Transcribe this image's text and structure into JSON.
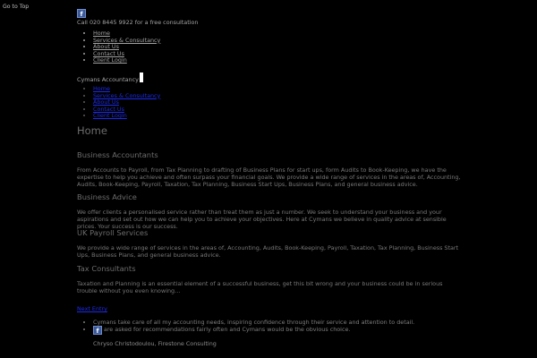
{
  "goto_top": "Go to Top",
  "header": {
    "facebook_icon": "facebook-icon",
    "call_text": "Call 020 8445 9922 for a free consultation",
    "nav": [
      "Home",
      "Services & Consultancy",
      "About Us",
      "Contact Us",
      "Client Login"
    ],
    "brand": "Cymans Accountancy"
  },
  "sub_nav": [
    "Home",
    "Services & Consultancy",
    "About Us",
    "Contact Us",
    "Client Login"
  ],
  "main": {
    "title": "Home",
    "sections": [
      {
        "heading": "Business Accountants",
        "text": "From Accounts to Payroll, from Tax Planning to drafting of Business Plans for start ups, form Audits to Book-Keeping, we have the expertise to help you achieve and often surpass your financial goals. We provide a wide range of services in the areas of, Accounting, Audits, Book-Keeping, Payroll, Taxation, Tax Planning, Business Start Ups, Business Plans, and general business advice."
      },
      {
        "heading": "Business Advice",
        "text": "We offer clients a personalised service rather than treat them as just a number. We seek to understand your business and your aspirations and set out how we can help you to achieve your objectives. Here at Cymans we believe in quality advice at sensible prices. Your success is our success."
      },
      {
        "heading": "UK Payroll Services",
        "text": "We provide a wide range of services in the areas of, Accounting, Audits, Book-Keeping, Payroll, Taxation, Tax Planning, Business Start Ups, Business Plans, and general business advice."
      },
      {
        "heading": "Tax Consultants",
        "text": "Taxation and Planning is an essential element of a successful business, get this bit wrong and your business could be in serious trouble without you even knowing…"
      }
    ],
    "next_link": "Next Entry"
  },
  "testimonials": [
    {
      "quote": "Cymans take care of all my accounting needs, inspiring confidence through their service and attention to detail.",
      "author": "Chryso Christodoulou, Firestone Consulting"
    },
    {
      "quote": "We are asked for recommendations fairly often and Cymans would be the obvious choice."
    }
  ],
  "colors": {
    "background": "#000000",
    "link": "#1d2be8",
    "text": "#9a9a9a"
  }
}
